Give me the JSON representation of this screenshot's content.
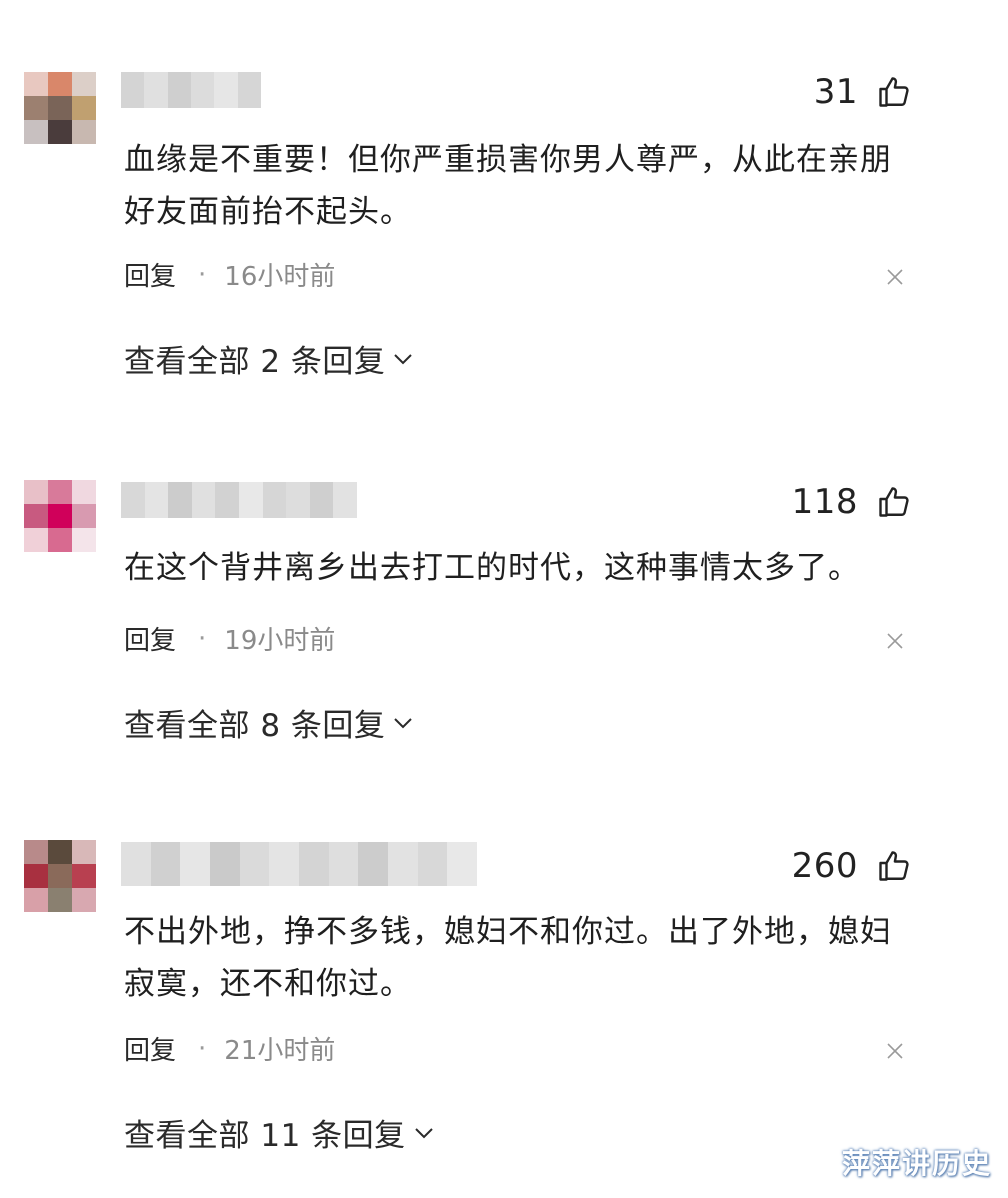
{
  "comments": [
    {
      "likes": "31",
      "text": "血缘是不重要！但你严重损害你男人尊严，从此在亲朋好友面前抬不起头。",
      "reply_label": "回复",
      "separator": "·",
      "time": "16小时前",
      "view_all": "查看全部 2 条回复",
      "avatar_colors": [
        "#e8c8c0",
        "#d9876a",
        "#dccfc8",
        "#9c8070",
        "#7a6458",
        "#c0a070",
        "#c8c0c0",
        "#4a3c3c",
        "#c8b8b0"
      ],
      "name_colors": [
        "#d4d4d4",
        "#e0e0e0",
        "#cfcfcf",
        "#dcdcdc",
        "#e6e6e6",
        "#d6d6d6"
      ]
    },
    {
      "likes": "118",
      "text": "在这个背井离乡出去打工的时代，这种事情太多了。",
      "reply_label": "回复",
      "separator": "·",
      "time": "19小时前",
      "view_all": "查看全部 8 条回复",
      "avatar_colors": [
        "#e8c0c8",
        "#d87a9a",
        "#f0d8e0",
        "#c85a80",
        "#d0005a",
        "#d89ab0",
        "#f0d0d8",
        "#d86a90",
        "#f4e4ea"
      ],
      "name_colors": [
        "#d8d8d8",
        "#e4e4e4",
        "#cccccc",
        "#e0e0e0",
        "#d2d2d2",
        "#e8e8e8",
        "#d6d6d6",
        "#dddddd",
        "#cfcfcf",
        "#e2e2e2"
      ]
    },
    {
      "likes": "260",
      "text": "不出外地，挣不多钱，媳妇不和你过。出了外地，媳妇寂寞，还不和你过。",
      "reply_label": "回复",
      "separator": "·",
      "time": "21小时前",
      "view_all": "查看全部 11 条回复",
      "avatar_colors": [
        "#b88a8a",
        "#5a4a3c",
        "#d8b8b8",
        "#a83040",
        "#8a6a5a",
        "#b84050",
        "#d8a0a8",
        "#8a8070",
        "#d8a8b0"
      ],
      "name_colors": [
        "#e0e0e0",
        "#d0d0d0",
        "#e6e6e6",
        "#cacaca",
        "#dadada",
        "#e4e4e4",
        "#d4d4d4",
        "#dedede",
        "#cccccc",
        "#e2e2e2",
        "#d8d8d8",
        "#e8e8e8"
      ]
    }
  ],
  "watermark": "萍萍讲历史",
  "icons": {
    "like": "thumbs-up-icon",
    "close": "close-icon",
    "expand": "chevron-down-icon"
  }
}
